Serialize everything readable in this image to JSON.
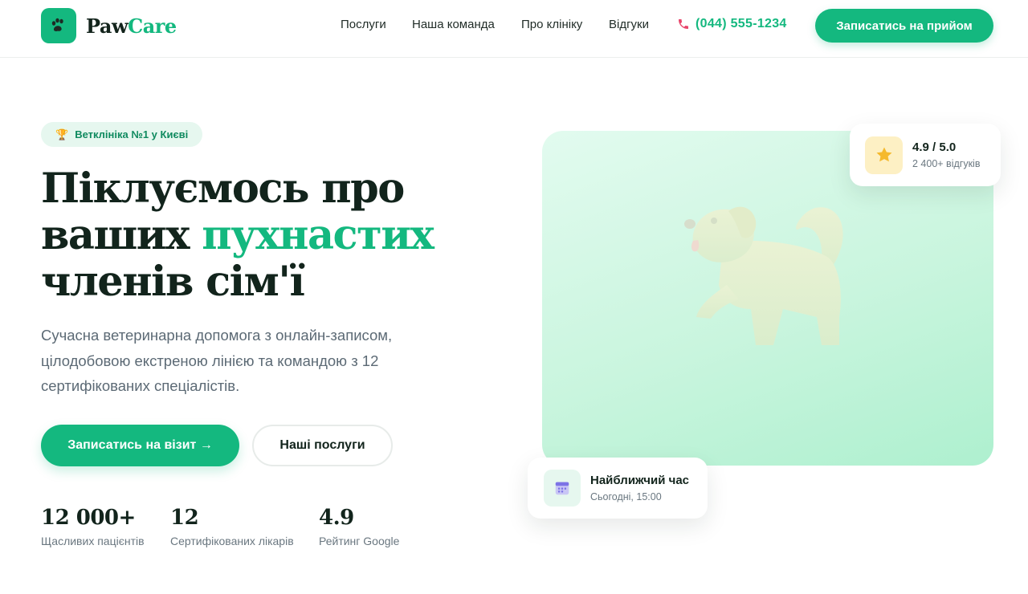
{
  "header": {
    "logo_part1": "Paw",
    "logo_part2": "Care",
    "nav": [
      "Послуги",
      "Наша команда",
      "Про клініку",
      "Відгуки"
    ],
    "phone": "(044) 555-1234",
    "cta": "Записатись на прийом"
  },
  "hero": {
    "badge": "Ветклініка №1 у Києві",
    "title_line1": "Піклуємось про",
    "title_line2_a": "ваших ",
    "title_line2_b": "пухнастих",
    "title_line3": "членів сім'ї",
    "description": "Сучасна ветеринарна допомога з онлайн-записом, цілодобовою екстреною лінією та командою з 12 сертифікованих спеціалістів.",
    "primary_button": "Записатись на візит →",
    "secondary_button": "Наші послуги",
    "stats": [
      {
        "value": "12 000+",
        "label": "Щасливих пацієнтів"
      },
      {
        "value": "12",
        "label": "Сертифікованих лікарів"
      },
      {
        "value": "4.9",
        "label": "Рейтинг Google"
      }
    ]
  },
  "rating_card": {
    "value": "4.9 / 5.0",
    "subtitle": "2 400+ відгуків"
  },
  "time_card": {
    "title": "Найближчий час",
    "subtitle": "Сьогодні, 15:00"
  },
  "colors": {
    "brand": "#14b87f",
    "text": "#12241c",
    "muted": "#5c6a75"
  },
  "icons": [
    "paw-icon",
    "trophy-icon",
    "phone-icon",
    "star-icon",
    "calendar-icon",
    "dog-illustration"
  ]
}
